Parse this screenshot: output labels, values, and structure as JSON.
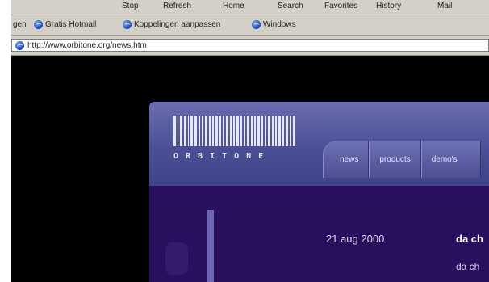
{
  "browser": {
    "menu": [
      "Stop",
      "Refresh",
      "Home",
      "Search",
      "Favorites",
      "History",
      "Mail"
    ],
    "links": [
      {
        "label": "gen",
        "has_icon": false
      },
      {
        "label": "Gratis Hotmail",
        "has_icon": true
      },
      {
        "label": "Koppelingen aanpassen",
        "has_icon": true
      },
      {
        "label": "Windows",
        "has_icon": true
      }
    ],
    "address": "http://www.orbitone.org/news.htm"
  },
  "site": {
    "logo": "ORBITONE",
    "tabs": [
      "news",
      "products",
      "demo's"
    ],
    "news": {
      "date": "21 aug 2000",
      "headline": "da ch",
      "snippet": "da ch"
    }
  },
  "colors": {
    "header": "#4b4f95",
    "body": "#2a0f5e",
    "chrome": "#d4d0c8"
  }
}
